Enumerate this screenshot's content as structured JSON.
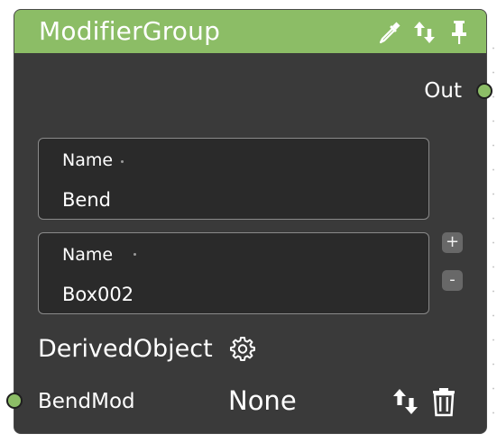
{
  "node": {
    "title": "ModifierGroup",
    "header_color": "#8cbd66",
    "body_color": "#3a3a3a",
    "header_icons": [
      "eyedropper-icon",
      "swap-updown-icon",
      "pin-icon"
    ]
  },
  "output": {
    "label": "Out",
    "port_color": "#8cbd66"
  },
  "fields": [
    {
      "label": "Name",
      "value": "Bend"
    },
    {
      "label": "Name",
      "value": "Box002"
    }
  ],
  "list_controls": {
    "add_label": "+",
    "remove_label": "-"
  },
  "section": {
    "title": "DerivedObject",
    "icon": "gear-icon"
  },
  "input_row": {
    "label": "BendMod",
    "value": "None",
    "port_color": "#8cbd66",
    "icons": [
      "swap-updown-icon",
      "trash-icon"
    ]
  }
}
